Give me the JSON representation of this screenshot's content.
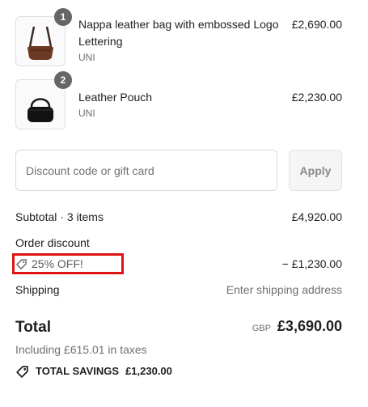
{
  "items": [
    {
      "quantity": "1",
      "name": "Nappa leather bag with embossed Logo Lettering",
      "variant": "UNI",
      "price": "£2,690.00",
      "image_icon": "brown-shoulder-bag-icon"
    },
    {
      "quantity": "2",
      "name": "Leather Pouch",
      "variant": "UNI",
      "price": "£2,230.00",
      "image_icon": "black-pouch-icon"
    }
  ],
  "discount": {
    "placeholder": "Discount code or gift card",
    "apply_label": "Apply"
  },
  "summary": {
    "subtotal_label": "Subtotal · 3 items",
    "subtotal_value": "£4,920.00",
    "order_discount_label": "Order discount",
    "discount_code": "25% OFF!",
    "discount_value": "− £1,230.00",
    "shipping_label": "Shipping",
    "shipping_value": "Enter shipping address",
    "total_label": "Total",
    "currency": "GBP",
    "total_value": "£3,690.00",
    "tax_text": "Including £615.01 in taxes",
    "savings_label": "TOTAL SAVINGS",
    "savings_value": "£1,230.00"
  },
  "colors": {
    "highlight_border": "#e01414",
    "badge": "#666666"
  }
}
